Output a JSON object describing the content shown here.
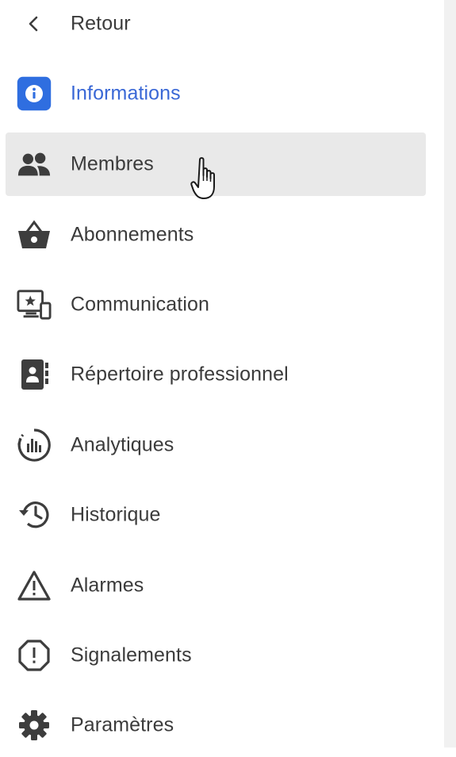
{
  "nav": {
    "back": {
      "label": "Retour",
      "icon": "chevron-left-icon"
    },
    "items": [
      {
        "label": "Informations",
        "icon": "info-icon",
        "state": "active"
      },
      {
        "label": "Membres",
        "icon": "people-icon",
        "state": "hover"
      },
      {
        "label": "Abonnements",
        "icon": "basket-icon"
      },
      {
        "label": "Communication",
        "icon": "screen-star-icon"
      },
      {
        "label": "Répertoire professionnel",
        "icon": "contact-book-icon"
      },
      {
        "label": "Analytiques",
        "icon": "analytics-icon"
      },
      {
        "label": "Historique",
        "icon": "history-icon"
      },
      {
        "label": "Alarmes",
        "icon": "warning-icon"
      },
      {
        "label": "Signalements",
        "icon": "report-icon"
      },
      {
        "label": "Paramètres",
        "icon": "gear-icon"
      }
    ]
  },
  "colors": {
    "accent": "#3a68d6",
    "accent_icon_bg": "#2f6ee0",
    "text": "#3b3b3b",
    "hover_bg": "#e9e9e9",
    "right_panel": "#f1f1f1"
  }
}
